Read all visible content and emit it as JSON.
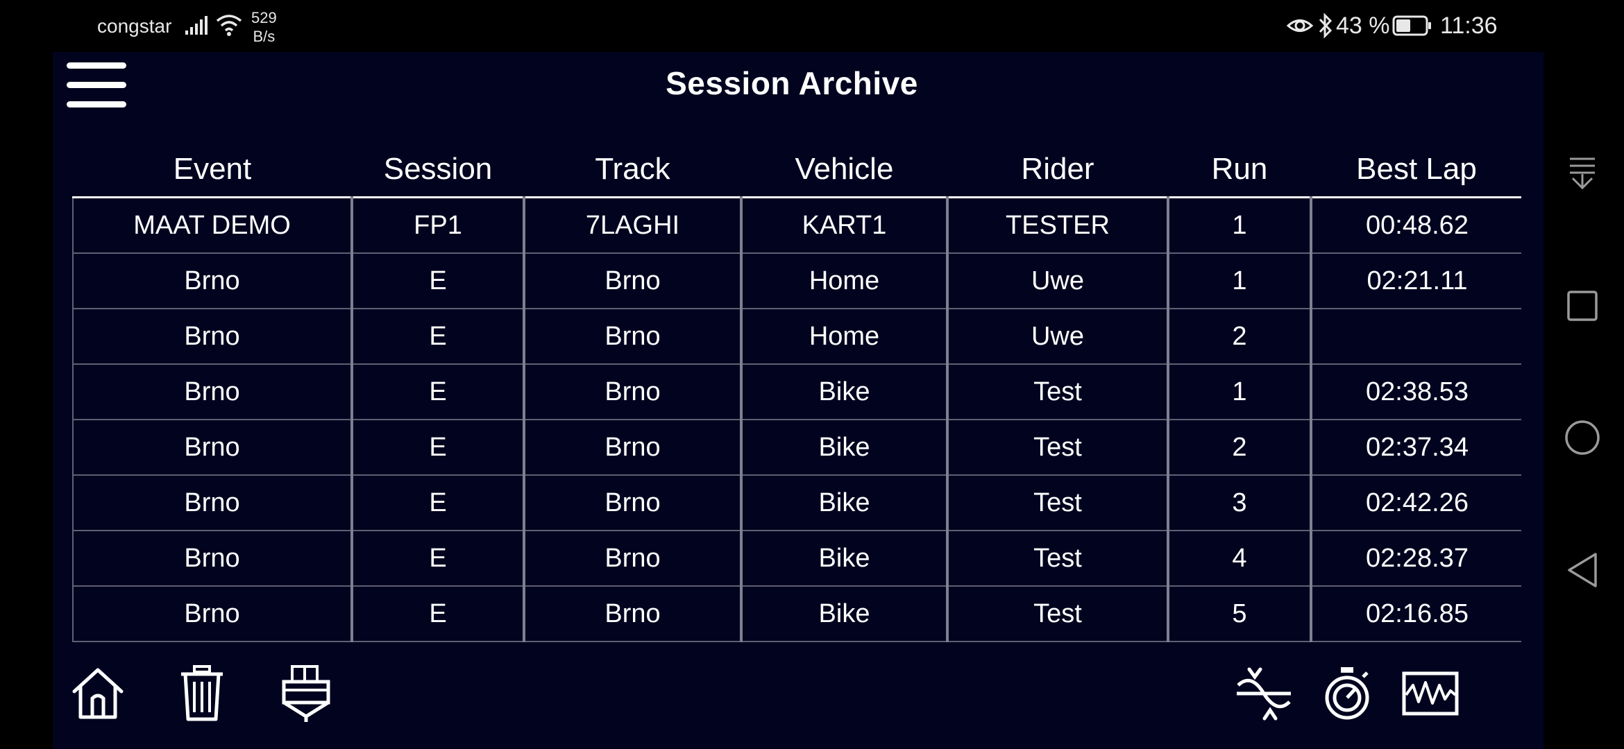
{
  "status_bar": {
    "carrier": "congstar",
    "net_speed_value": "529",
    "net_speed_unit": "B/s",
    "battery": "43 %",
    "time": "11:36",
    "icons": [
      "signal-icon",
      "wifi-icon",
      "eye-icon",
      "bluetooth-icon",
      "battery-icon"
    ]
  },
  "header": {
    "title": "Session Archive",
    "menu_icon": "hamburger-menu-icon"
  },
  "table": {
    "columns": [
      "Event",
      "Session",
      "Track",
      "Vehicle",
      "Rider",
      "Run",
      "Best Lap"
    ],
    "rows": [
      [
        "MAAT DEMO",
        "FP1",
        "7LAGHI",
        "KART1",
        "TESTER",
        "1",
        "00:48.62"
      ],
      [
        "Brno",
        "E",
        "Brno",
        "Home",
        "Uwe",
        "1",
        "02:21.11"
      ],
      [
        "Brno",
        "E",
        "Brno",
        "Home",
        "Uwe",
        "2",
        ""
      ],
      [
        "Brno",
        "E",
        "Brno",
        "Bike",
        "Test",
        "1",
        "02:38.53"
      ],
      [
        "Brno",
        "E",
        "Brno",
        "Bike",
        "Test",
        "2",
        "02:37.34"
      ],
      [
        "Brno",
        "E",
        "Brno",
        "Bike",
        "Test",
        "3",
        "02:42.26"
      ],
      [
        "Brno",
        "E",
        "Brno",
        "Bike",
        "Test",
        "4",
        "02:28.37"
      ],
      [
        "Brno",
        "E",
        "Brno",
        "Bike",
        "Test",
        "5",
        "02:16.85"
      ]
    ]
  },
  "toolbar": {
    "left": [
      "home-icon",
      "trash-icon",
      "export-icon"
    ],
    "right": [
      "sectors-icon",
      "stopwatch-icon",
      "signal-chart-icon"
    ]
  },
  "nav_bar": [
    "notification-pull-icon",
    "recents-square-icon",
    "home-circle-icon",
    "back-triangle-icon"
  ],
  "colors": {
    "app_background": "#02041f",
    "screen_background": "#000000",
    "text": "#ffffff",
    "grid_lines": "#7e7f92"
  }
}
